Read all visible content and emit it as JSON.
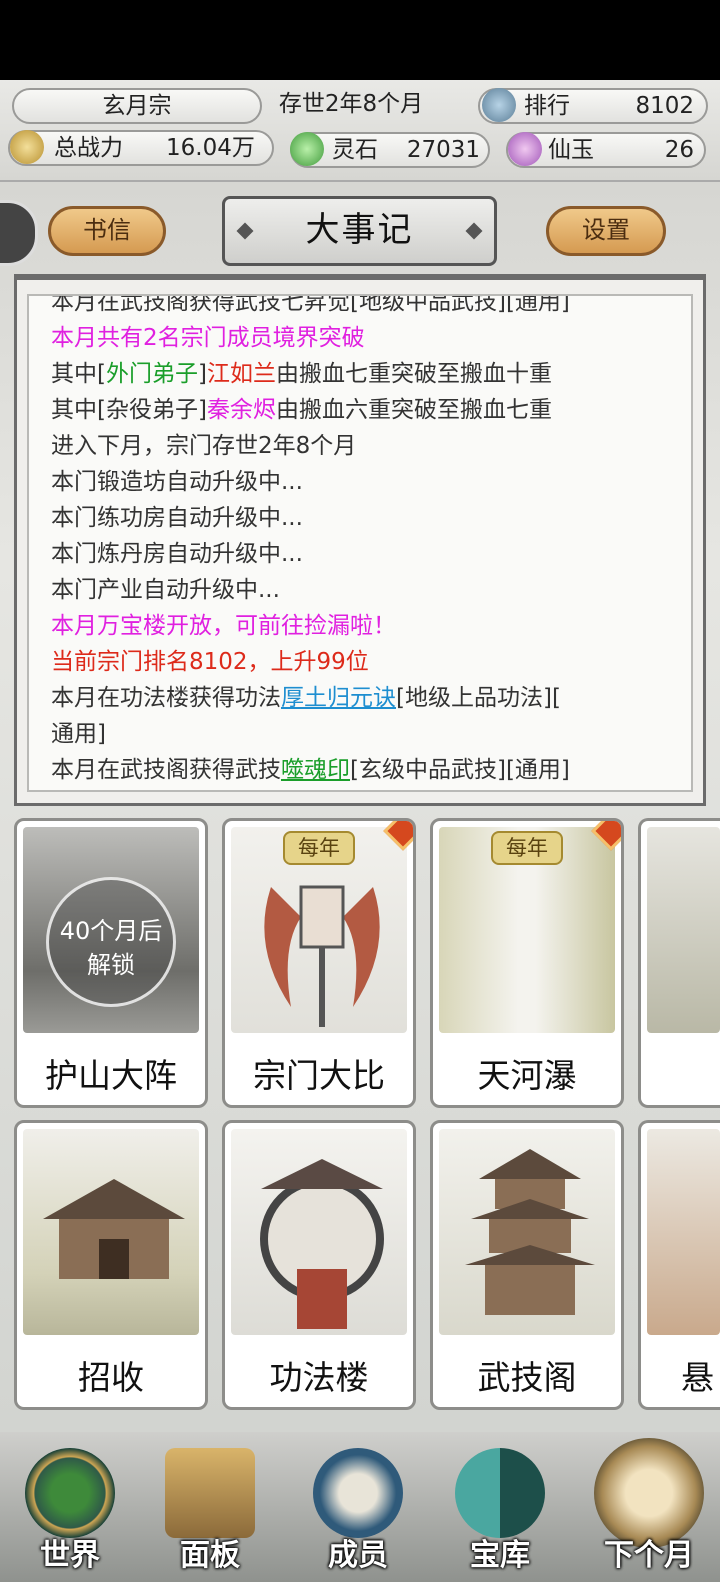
{
  "header": {
    "sect_name": "玄月宗",
    "age": "存世2年8个月",
    "rank_label": "排行",
    "rank_value": "8102",
    "power_label": "总战力",
    "power_value": "16.04万",
    "lingshi_label": "灵石",
    "lingshi_value": "27031",
    "xianyu_label": "仙玉",
    "xianyu_value": "26"
  },
  "toolbar": {
    "letters_label": "书信",
    "title": "大事记",
    "settings_label": "设置"
  },
  "log": {
    "line0": "本月在武技阁获得武技七昇觉[地级中品武技][通用]",
    "line1": "本月共有2名宗门成员境界突破",
    "line2_a": "其中[",
    "line2_b": "外门弟子",
    "line2_c": "]",
    "line2_d": "江如兰",
    "line2_e": "由搬血七重突破至搬血十重",
    "line3_a": "其中[杂役弟子]",
    "line3_b": "秦余烬",
    "line3_c": "由搬血六重突破至搬血七重",
    "line4": "进入下月，宗门存世2年8个月",
    "line5": "本门锻造坊自动升级中...",
    "line6": "本门练功房自动升级中...",
    "line7": "本门炼丹房自动升级中...",
    "line8": "本门产业自动升级中...",
    "line9": "本月万宝楼开放，可前往捡漏啦！",
    "line10": "当前宗门排名8102，上升99位",
    "line11_a": "本月在功法楼获得功法",
    "line11_b": "厚土归元诀",
    "line11_c": "[地级上品功法][",
    "line12": "通用]",
    "line13_a": "本月在武技阁获得武技",
    "line13_b": "噬魂印",
    "line13_c": "[玄级中品武技][通用]"
  },
  "cards": {
    "c1_label": "护山大阵",
    "c1_lock_line1": "40个月后",
    "c1_lock_line2": "解锁",
    "c2_label": "宗门大比",
    "c2_badge": "每年",
    "c3_label": "天河瀑",
    "c3_badge": "每年",
    "c5_label": "招收",
    "c6_label": "功法楼",
    "c7_label": "武技阁",
    "c8_label": "悬"
  },
  "nav": {
    "world": "世界",
    "panel": "面板",
    "members": "成员",
    "treasury": "宝库",
    "next_month": "下个月"
  },
  "colors": {
    "highlight_pink": "#e020e0",
    "highlight_red": "#dd2a1a",
    "highlight_green": "#1a9e2a",
    "link_blue": "#1e8ed0",
    "gold_button": "#d59a51"
  }
}
